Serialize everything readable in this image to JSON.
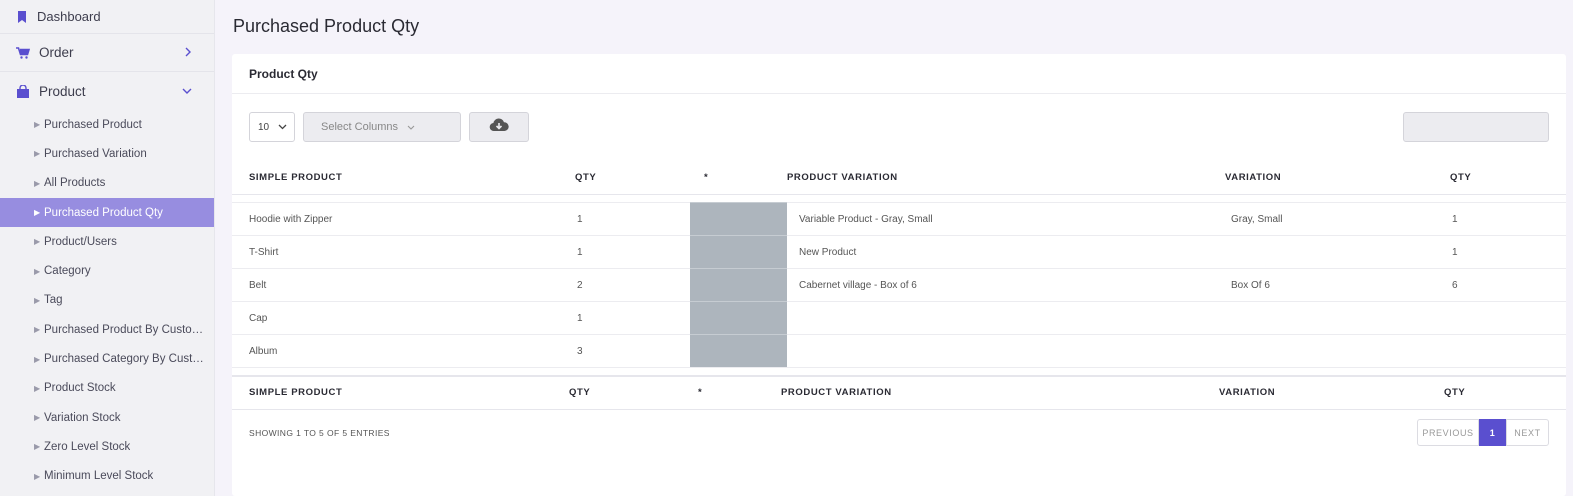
{
  "sidebar": {
    "dashboard": "Dashboard",
    "order": "Order",
    "product": "Product",
    "sub_items": [
      "Purchased Product",
      "Purchased Variation",
      "All Products",
      "Purchased Product Qty",
      "Product/Users",
      "Category",
      "Tag",
      "Purchased Product By Customer",
      "Purchased Category By Customer",
      "Product Stock",
      "Variation Stock",
      "Zero Level Stock",
      "Minimum Level Stock"
    ],
    "active_item": "Purchased Product Qty"
  },
  "page": {
    "title": "Purchased Product Qty"
  },
  "card": {
    "title": "Product Qty"
  },
  "toolbar": {
    "page_length": "10",
    "select_columns": "Select Columns",
    "search_value": ""
  },
  "table": {
    "headers": [
      "SIMPLE PRODUCT",
      "QTY",
      "*",
      "PRODUCT VARIATION",
      "VARIATION",
      "QTY"
    ],
    "rows": [
      [
        "Hoodie with Zipper",
        "1",
        "",
        "Variable Product - Gray, Small",
        "Gray, Small",
        "1"
      ],
      [
        "T-Shirt",
        "1",
        "",
        "New Product",
        "",
        "1"
      ],
      [
        "Belt",
        "2",
        "",
        "Cabernet village - Box of 6",
        "Box Of 6",
        "6"
      ],
      [
        "Cap",
        "1",
        "",
        "",
        "",
        ""
      ],
      [
        "Album",
        "3",
        "",
        "",
        "",
        ""
      ]
    ]
  },
  "footer": {
    "info": "SHOWING 1 TO 5 OF 5 ENTRIES",
    "previous": "PREVIOUS",
    "current_page": "1",
    "next": "NEXT"
  },
  "colors": {
    "accent": "#5a4fcf",
    "active_item_bg": "#978de0",
    "gray_cell": "#adb5bd"
  }
}
